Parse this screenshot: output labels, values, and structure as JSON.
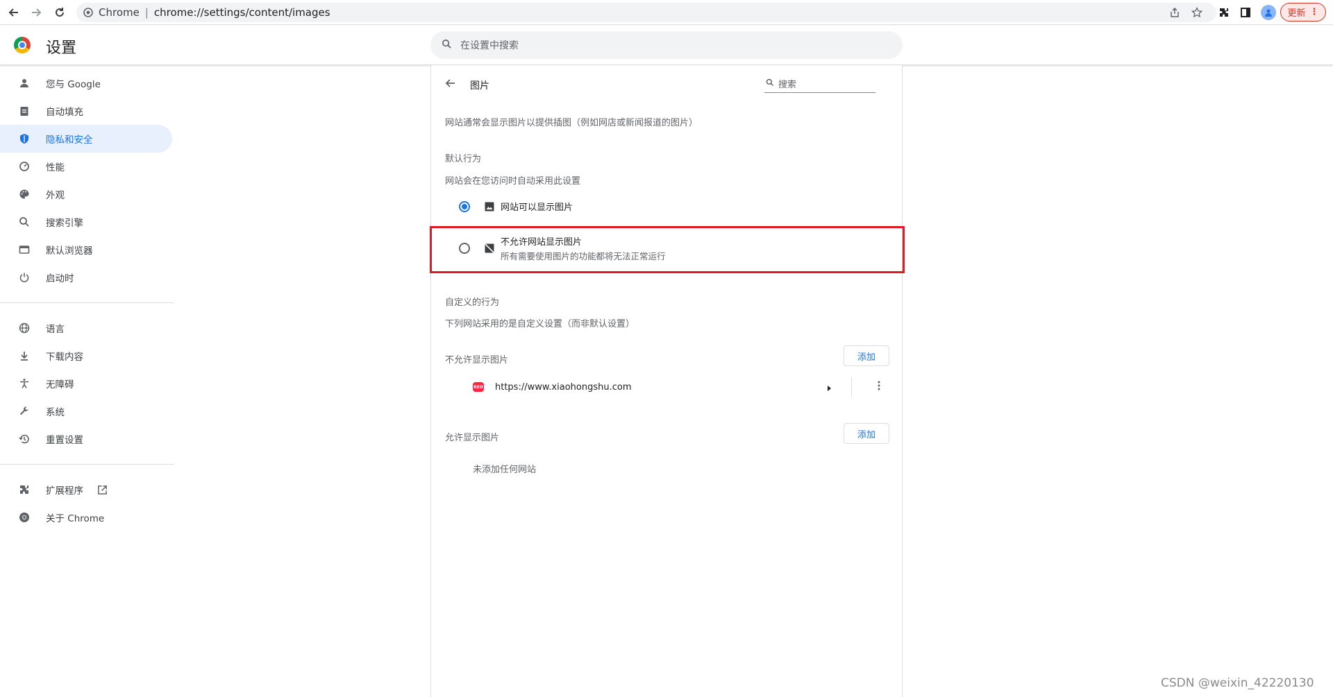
{
  "browser": {
    "omnibox_site": "Chrome",
    "omnibox_url": "chrome://settings/content/images",
    "update_label": "更新"
  },
  "header": {
    "title": "设置",
    "search_placeholder": "在设置中搜索"
  },
  "sidebar": {
    "items": [
      {
        "label": "您与 Google",
        "icon": "person-icon"
      },
      {
        "label": "自动填充",
        "icon": "clipboard-icon"
      },
      {
        "label": "隐私和安全",
        "icon": "shield-icon",
        "active": true
      },
      {
        "label": "性能",
        "icon": "speedometer-icon"
      },
      {
        "label": "外观",
        "icon": "palette-icon"
      },
      {
        "label": "搜索引擎",
        "icon": "search-icon"
      },
      {
        "label": "默认浏览器",
        "icon": "browser-window-icon"
      },
      {
        "label": "启动时",
        "icon": "power-icon"
      }
    ],
    "items2": [
      {
        "label": "语言",
        "icon": "globe-icon"
      },
      {
        "label": "下载内容",
        "icon": "download-icon"
      },
      {
        "label": "无障碍",
        "icon": "accessibility-icon"
      },
      {
        "label": "系统",
        "icon": "wrench-icon"
      },
      {
        "label": "重置设置",
        "icon": "history-icon"
      }
    ],
    "items3": [
      {
        "label": "扩展程序",
        "icon": "puzzle-icon"
      },
      {
        "label": "关于 Chrome",
        "icon": "chrome-icon"
      }
    ]
  },
  "page": {
    "title": "图片",
    "search_placeholder": "搜索",
    "description": "网站通常会显示图片以提供插图（例如网店或新闻报道的图片）",
    "default_heading": "默认行为",
    "default_desc": "网站会在您访问时自动采用此设置",
    "option_allow": "网站可以显示图片",
    "option_block": "不允许网站显示图片",
    "option_block_sub": "所有需要使用图片的功能都将无法正常运行",
    "custom_heading": "自定义的行为",
    "custom_desc": "下列网站采用的是自定义设置（而非默认设置）",
    "blocked_heading": "不允许显示图片",
    "add_label": "添加",
    "blocked_site": "https://www.xiaohongshu.com",
    "allowed_heading": "允许显示图片",
    "allowed_empty": "未添加任何网站",
    "selected_option": "allow"
  },
  "watermark": "CSDN @weixin_42220130",
  "colors": {
    "accent": "#1a73e8",
    "highlight": "#e01b24"
  }
}
